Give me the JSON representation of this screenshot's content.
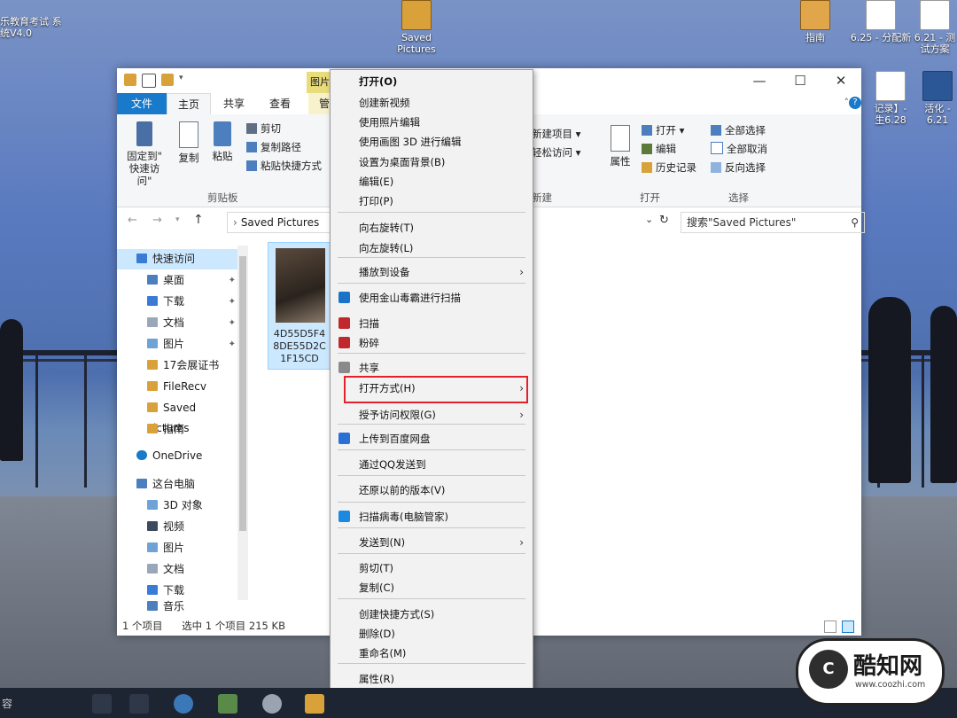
{
  "desktop": {
    "icons": [
      {
        "label": "Saved\nPictures"
      },
      {
        "label": "指南"
      },
      {
        "label": "6.25 - 分配新"
      },
      {
        "label": "6.21 - 测试方案"
      }
    ],
    "left_icon_label": "乐教育考试 系统V4.0",
    "right_partial_labels": [
      "记录】- 生6.28",
      "活化 - 6.21"
    ]
  },
  "explorer": {
    "picture_tools_tab": "图片",
    "tabs": {
      "file": "文件",
      "home": "主页",
      "share": "共享",
      "view": "查看",
      "manage": "管"
    },
    "window_buttons": {
      "minimize": "—",
      "maximize": "☐",
      "close": "✕"
    },
    "ribbon": {
      "pin_label": "固定到\"\n快速访问\"",
      "copy_label": "复制",
      "paste_label": "粘贴",
      "cut_label": "剪切",
      "copy_path_label": "复制路径",
      "paste_shortcut_label": "粘贴快捷方式",
      "clipboard_group": "剪贴板",
      "new_item_label": "新建项目 ▾",
      "easy_access_label": "轻松访问 ▾",
      "new_group": "新建",
      "properties_label": "属性",
      "open_label": "打开 ▾",
      "edit_label": "编辑",
      "history_label": "历史记录",
      "open_group": "打开",
      "select_all_label": "全部选择",
      "select_none_label": "全部取消",
      "invert_select_label": "反向选择",
      "select_group": "选择"
    },
    "address": {
      "path": "Saved Pictures",
      "search_placeholder": "搜索\"Saved Pictures\""
    },
    "nav": {
      "quick_access": "快速访问",
      "items": [
        {
          "label": "桌面",
          "pinned": true
        },
        {
          "label": "下载",
          "pinned": true
        },
        {
          "label": "文档",
          "pinned": true
        },
        {
          "label": "图片",
          "pinned": true
        },
        {
          "label": "17会展证书",
          "pinned": false
        },
        {
          "label": "FileRecv",
          "pinned": false
        },
        {
          "label": "Saved Pictures",
          "pinned": false
        },
        {
          "label": "指南",
          "pinned": false
        }
      ],
      "onedrive": "OneDrive",
      "this_pc": "这台电脑",
      "pc_items": [
        "3D 对象",
        "视频",
        "图片",
        "文档",
        "下载",
        "音乐"
      ]
    },
    "file": {
      "name": "4D55D5F4 8DE55D2C 1F15CD"
    },
    "status": {
      "count": "1 个项目",
      "selected": "选中 1 个项目  215 KB"
    }
  },
  "context_menu": {
    "items": [
      {
        "label": "打开(O)",
        "bold": true,
        "icon": null,
        "submenu": false
      },
      {
        "label": "创建新视频",
        "bold": false,
        "icon": null,
        "submenu": false
      },
      {
        "label": "使用照片编辑",
        "bold": false,
        "icon": null,
        "submenu": false
      },
      {
        "label": "使用画图 3D 进行编辑",
        "bold": false,
        "icon": null,
        "submenu": false
      },
      {
        "label": "设置为桌面背景(B)",
        "bold": false,
        "icon": null,
        "submenu": false
      },
      {
        "label": "编辑(E)",
        "bold": false,
        "icon": null,
        "submenu": false
      },
      {
        "label": "打印(P)",
        "bold": false,
        "icon": null,
        "submenu": false
      },
      {
        "label": "向右旋转(T)",
        "bold": false,
        "icon": null,
        "submenu": false
      },
      {
        "label": "向左旋转(L)",
        "bold": false,
        "icon": null,
        "submenu": false
      },
      {
        "label": "播放到设备",
        "bold": false,
        "icon": null,
        "submenu": true
      },
      {
        "label": "使用金山毒霸进行扫描",
        "bold": false,
        "icon": "kingsoft-icon",
        "submenu": false
      },
      {
        "label": "扫描",
        "bold": false,
        "icon": "mcafee-icon",
        "submenu": false
      },
      {
        "label": "粉碎",
        "bold": false,
        "icon": "mcafee-icon",
        "submenu": false
      },
      {
        "label": "共享",
        "bold": false,
        "icon": "share-icon",
        "submenu": false
      },
      {
        "label": "打开方式(H)",
        "bold": false,
        "icon": null,
        "submenu": true
      },
      {
        "label": "授予访问权限(G)",
        "bold": false,
        "icon": null,
        "submenu": true
      },
      {
        "label": "上传到百度网盘",
        "bold": false,
        "icon": "baidu-cloud-icon",
        "submenu": false
      },
      {
        "label": "通过QQ发送到",
        "bold": false,
        "icon": null,
        "submenu": false
      },
      {
        "label": "还原以前的版本(V)",
        "bold": false,
        "icon": null,
        "submenu": false
      },
      {
        "label": "扫描病毒(电脑管家)",
        "bold": false,
        "icon": "tencent-manager-icon",
        "submenu": false
      },
      {
        "label": "发送到(N)",
        "bold": false,
        "icon": null,
        "submenu": true
      },
      {
        "label": "剪切(T)",
        "bold": false,
        "icon": null,
        "submenu": false
      },
      {
        "label": "复制(C)",
        "bold": false,
        "icon": null,
        "submenu": false
      },
      {
        "label": "创建快捷方式(S)",
        "bold": false,
        "icon": null,
        "submenu": false
      },
      {
        "label": "删除(D)",
        "bold": false,
        "icon": null,
        "submenu": false
      },
      {
        "label": "重命名(M)",
        "bold": false,
        "icon": null,
        "submenu": false
      },
      {
        "label": "属性(R)",
        "bold": false,
        "icon": null,
        "submenu": false
      }
    ],
    "highlighted": "打开方式(H)"
  },
  "watermark": {
    "logo": "C",
    "title": "酷知网",
    "url": "www.coozhi.com"
  },
  "taskbar": {
    "left_text": "容"
  },
  "colors": {
    "accent": "#1979ca",
    "highlight_box": "#e2222a",
    "selection": "#cce8ff"
  }
}
